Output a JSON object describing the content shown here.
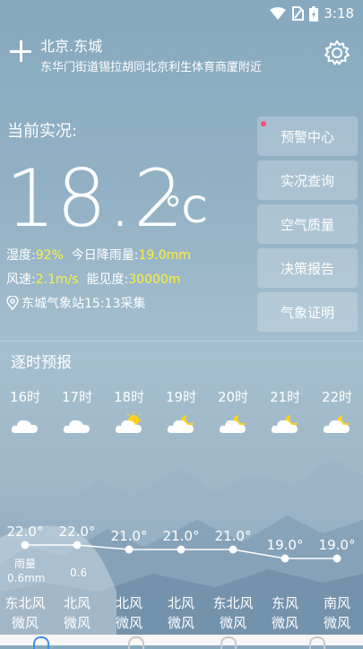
{
  "status_bar": {
    "time": "3:18"
  },
  "header": {
    "location": "北京.东城",
    "address": "东华门街道锡拉胡同北京利生体育商厦附近"
  },
  "current": {
    "label": "当前实况:",
    "temperature": "18.2",
    "unit": "°C",
    "humidity_label": "湿度:",
    "humidity_value": "92%",
    "rain_label": "今日降雨量:",
    "rain_value": "19.0mm",
    "wind_label": "风速:",
    "wind_value": "2.1m/s",
    "visibility_label": "能见度:",
    "visibility_value": "30000m",
    "station": "东城气象站15:13采集"
  },
  "side_buttons": [
    {
      "label": "预警中心",
      "icon": "red-dot"
    },
    {
      "label": "实况查询"
    },
    {
      "label": "空气质量"
    },
    {
      "label": "决策报告"
    },
    {
      "label": "气象证明"
    }
  ],
  "hourly": {
    "title": "逐时预报",
    "hours": [
      {
        "time": "16时",
        "icon": "cloudy-icon"
      },
      {
        "time": "17时",
        "icon": "cloudy-icon"
      },
      {
        "time": "18时",
        "icon": "partly-cloudy-sun-icon"
      },
      {
        "time": "19时",
        "icon": "partly-cloudy-night-icon"
      },
      {
        "time": "20时",
        "icon": "partly-cloudy-night-icon"
      },
      {
        "time": "21时",
        "icon": "partly-cloudy-night-icon"
      },
      {
        "time": "22时",
        "icon": "partly-cloudy-night-icon"
      }
    ],
    "temps": [
      "22.0°",
      "22.0°",
      "21.0°",
      "21.0°",
      "21.0°",
      "19.0°",
      "19.0°"
    ],
    "temp_values": [
      22.0,
      22.0,
      21.0,
      21.0,
      21.0,
      19.0,
      19.0
    ],
    "rain_label": "雨量",
    "rain_total": "0.6mm",
    "rain_value": "0.6",
    "winds": [
      {
        "dir": "东北风",
        "level": "微风"
      },
      {
        "dir": "北风",
        "level": "微风"
      },
      {
        "dir": "北风",
        "level": "微风"
      },
      {
        "dir": "北风",
        "level": "微风"
      },
      {
        "dir": "东北风",
        "level": "微风"
      },
      {
        "dir": "东风",
        "level": "微风"
      },
      {
        "dir": "南风",
        "level": "微风"
      }
    ]
  },
  "colors": {
    "highlight": "#fff23a",
    "alert_dot": "#ff4a7a",
    "active_tab": "#3e8fe8"
  }
}
